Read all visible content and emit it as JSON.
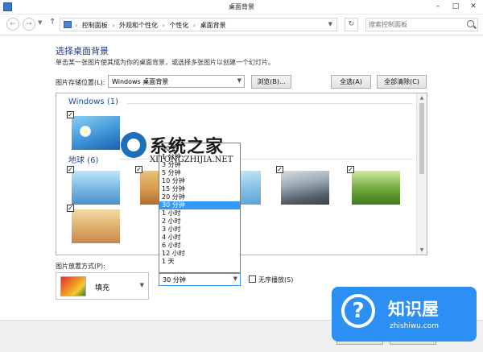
{
  "window": {
    "title": "桌面背景"
  },
  "address": {
    "breadcrumbs": [
      "控制面板",
      "外观和个性化",
      "个性化",
      "桌面背景"
    ],
    "search_placeholder": "搜索控制面板"
  },
  "main": {
    "heading": "选择桌面背景",
    "subtitle": "单击某一张图片使其成为你的桌面背景，或选择多张图片以创建一个幻灯片。",
    "location_label": "图片存储位置(L):",
    "location_value": "Windows 桌面背景",
    "browse_label": "浏览(B)...",
    "select_all_label": "全选(A)",
    "clear_all_label": "全部清除(C)",
    "groups": [
      {
        "label": "Windows (1)"
      },
      {
        "label": "地球 (6)"
      }
    ],
    "picture_position_label": "图片放置方式(P):",
    "picture_position_value": "填充",
    "change_interval_value": "30 分钟",
    "shuffle_label": "无序播放(S)",
    "interval_options": [
      "30 秒",
      "1 分钟",
      "3 分钟",
      "5 分钟",
      "10 分钟",
      "15 分钟",
      "20 分钟",
      "30 分钟",
      "1 小时",
      "2 小时",
      "3 小时",
      "4 小时",
      "6 小时",
      "12 小时",
      "1 天"
    ],
    "selected_interval_index": 7
  },
  "watermarks": {
    "site1_name": "系统之家",
    "site1_domain": "XITONGZHIJIA.NET",
    "site2_name": "知识屋",
    "site2_domain": "zhishiwu.com"
  },
  "colors": {
    "accent": "#3399ff",
    "heading": "#1e3a8a",
    "badge": "#2b8ff3"
  }
}
